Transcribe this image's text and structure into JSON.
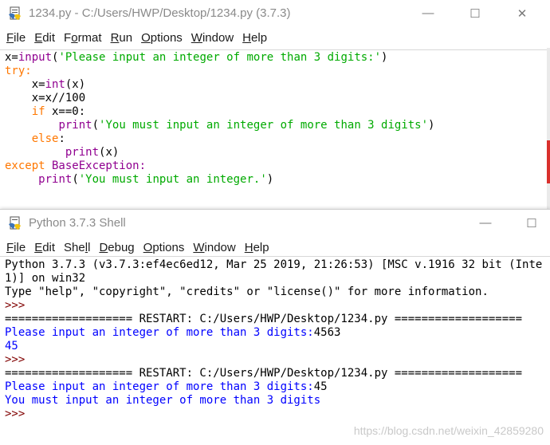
{
  "editor": {
    "title": "1234.py - C:/Users/HWP/Desktop/1234.py (3.7.3)",
    "menu": [
      {
        "u": "F",
        "rest": "ile"
      },
      {
        "u": "E",
        "rest": "dit"
      },
      {
        "pre": "F",
        "u": "o",
        "rest": "rmat"
      },
      {
        "u": "R",
        "rest": "un"
      },
      {
        "u": "O",
        "rest": "ptions"
      },
      {
        "u": "W",
        "rest": "indow"
      },
      {
        "u": "H",
        "rest": "elp"
      }
    ],
    "code": {
      "l1a": "x=",
      "l1b": "input",
      "l1c": "(",
      "l1d": "'Please input an integer of more than 3 digits:'",
      "l1e": ")",
      "l2": "try:",
      "l3a": "    x=",
      "l3b": "int",
      "l3c": "(x)",
      "l4": "    x=x//100",
      "l5a": "    ",
      "l5b": "if",
      "l5c": " x==0:",
      "l6a": "        ",
      "l6b": "print",
      "l6c": "(",
      "l6d": "'You must input an integer of more than 3 digits'",
      "l6e": ")",
      "l7a": "    ",
      "l7b": "else",
      "l7c": ":",
      "l8a": "         ",
      "l8b": "print",
      "l8c": "(x)",
      "l9a": "except",
      "l9b": " BaseException:",
      "l10a": "     ",
      "l10b": "print",
      "l10c": "(",
      "l10d": "'You must input an integer.'",
      "l10e": ")"
    }
  },
  "shell": {
    "title": "Python 3.7.3 Shell",
    "menu": [
      {
        "u": "F",
        "rest": "ile"
      },
      {
        "u": "E",
        "rest": "dit"
      },
      {
        "pre": "She",
        "u": "l",
        "rest": "l"
      },
      {
        "u": "D",
        "rest": "ebug"
      },
      {
        "u": "O",
        "rest": "ptions"
      },
      {
        "u": "W",
        "rest": "indow"
      },
      {
        "u": "H",
        "rest": "elp"
      }
    ],
    "lines": {
      "banner1": "Python 3.7.3 (v3.7.3:ef4ec6ed12, Mar 25 2019, 21:26:53) [MSC v.1916 32 bit (Inte",
      "banner2": "1)] on win32",
      "banner3": "Type \"help\", \"copyright\", \"credits\" or \"license()\" for more information.",
      "prompt": ">>> ",
      "restart": "=================== RESTART: C:/Users/HWP/Desktop/1234.py ===================",
      "ask1": "Please input an integer of more than 3 digits:",
      "ans1": "4563",
      "out1": "45",
      "ask2": "Please input an integer of more than 3 digits:",
      "ans2": "45",
      "out2": "You must input an integer of more than 3 digits"
    }
  },
  "controls": {
    "minimize": "—",
    "maximize": "☐",
    "close": "✕"
  },
  "watermark": "https://blog.csdn.net/weixin_42859280"
}
